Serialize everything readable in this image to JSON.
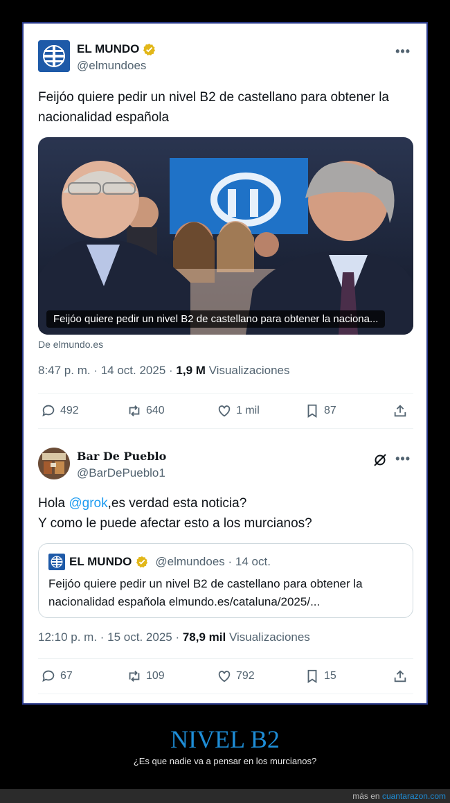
{
  "tweet1": {
    "name": "EL MUNDO",
    "handle": "@elmundoes",
    "text": "Feijóo quiere pedir un nivel B2 de castellano para obtener la nacionalidad española",
    "media_caption": "Feijóo quiere pedir un nivel B2 de castellano para obtener la naciona...",
    "source": "De elmundo.es",
    "time": "8:47 p. m. · 14 oct. 2025 · ",
    "views_count": "1,9 M",
    "views_label": " Visualizaciones",
    "replies": "492",
    "reposts": "640",
    "likes": "1 mil",
    "bookmarks": "87"
  },
  "tweet2": {
    "name": "Bar De Pueblo",
    "handle": "@BarDePueblo1",
    "text_pre": "Hola ",
    "mention": "@grok",
    "text_post": ",es verdad esta noticia?",
    "text_line2": "Y como le puede afectar esto a los murcianos?",
    "quote": {
      "name": "EL MUNDO",
      "meta": "@elmundoes · 14 oct.",
      "text": "Feijóo quiere pedir un nivel B2 de castellano para obtener la nacionalidad española elmundo.es/cataluna/2025/..."
    },
    "time": "12:10 p. m. · 15 oct. 2025 · ",
    "views_count": "78,9 mil",
    "views_label": " Visualizaciones",
    "replies": "67",
    "reposts": "109",
    "likes": "792",
    "bookmarks": "15"
  },
  "footer": {
    "title": "NIVEL B2",
    "subtitle": "¿Es que nadie va a pensar en los murcianos?",
    "credit_prefix": "más en ",
    "credit_site": "cuantarazon.com"
  },
  "colors": {
    "accent": "#1d9bf0",
    "footer_title": "#1e8dd6",
    "frame_border": "#2a3a8c"
  },
  "icons": [
    "globe-logo-icon",
    "verified-gold-icon",
    "more-icon",
    "grok-icon",
    "reply-icon",
    "repost-icon",
    "like-icon",
    "bookmark-icon",
    "share-icon"
  ]
}
